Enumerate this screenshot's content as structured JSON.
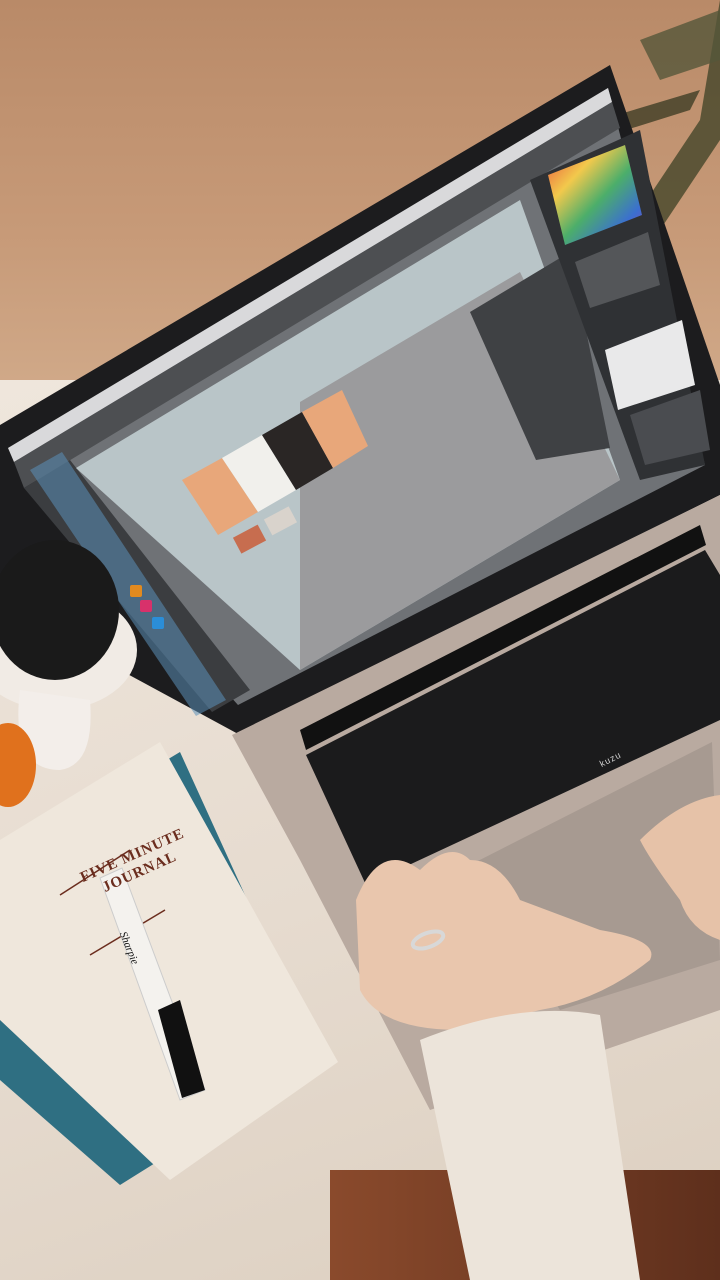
{
  "journal": {
    "title_line1": "FIVE MINUTE",
    "title_line2": "JOURNAL"
  },
  "marker": {
    "brand": "Sharpie"
  },
  "keyboard": {
    "brand": "kuzu"
  },
  "colors": {
    "wall": "#c79a78",
    "desk": "#ebe1d6",
    "app_canvas": "#b9c5c8",
    "artboard_peach": "#e8a77a",
    "artboard_white": "#f1f0ec",
    "artboard_black": "#2a2625"
  },
  "icons": [
    "adobe-illustrator-icon",
    "adobe-indesign-icon",
    "adobe-photoshop-icon"
  ]
}
